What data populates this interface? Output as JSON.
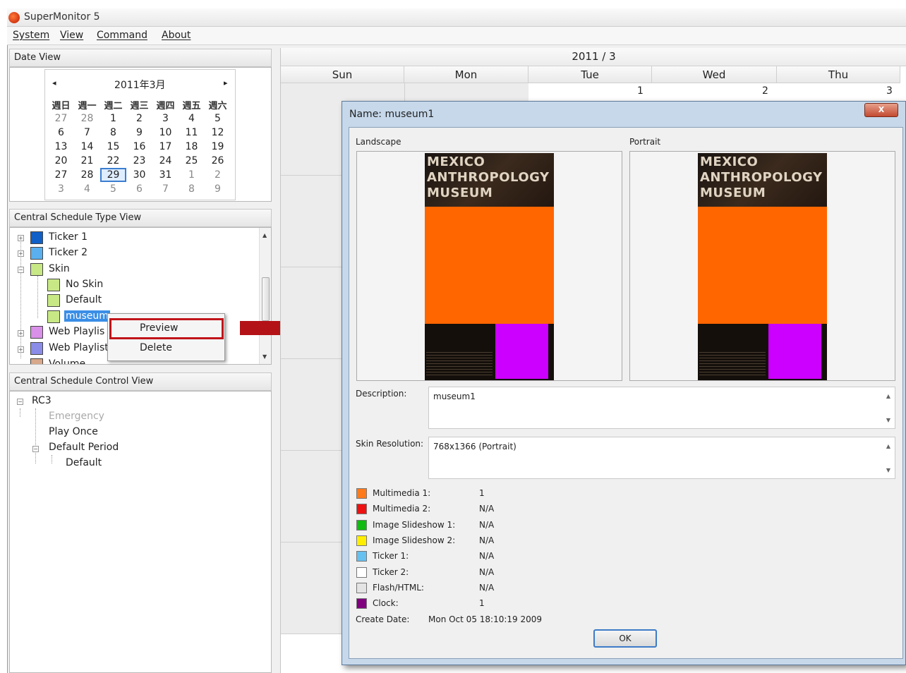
{
  "app": {
    "title": "SuperMonitor 5"
  },
  "menu": {
    "items": [
      "System",
      "View",
      "Command",
      "About"
    ]
  },
  "date_view": {
    "header": "Date View",
    "month_label": "2011年3月",
    "prev": "◂",
    "next": "▸",
    "weekdays": [
      "週日",
      "週一",
      "週二",
      "週三",
      "週四",
      "週五",
      "週六"
    ],
    "weeks": [
      [
        "27",
        "28",
        "1",
        "2",
        "3",
        "4",
        "5"
      ],
      [
        "6",
        "7",
        "8",
        "9",
        "10",
        "11",
        "12"
      ],
      [
        "13",
        "14",
        "15",
        "16",
        "17",
        "18",
        "19"
      ],
      [
        "20",
        "21",
        "22",
        "23",
        "24",
        "25",
        "26"
      ],
      [
        "27",
        "28",
        "29",
        "30",
        "31",
        "1",
        "2"
      ],
      [
        "3",
        "4",
        "5",
        "6",
        "7",
        "8",
        "9"
      ]
    ],
    "selected": "29"
  },
  "type_view": {
    "header": "Central Schedule Type View",
    "items": [
      {
        "label": "Ticker 1",
        "color": "#1060c8"
      },
      {
        "label": "Ticker 2",
        "color": "#5ab0ee"
      },
      {
        "label": "Skin",
        "color": "#c8e886"
      },
      {
        "label": "No Skin",
        "color": "#c8e886"
      },
      {
        "label": "Default",
        "color": "#c8e886"
      },
      {
        "label": "museum",
        "color": "#c8e886"
      },
      {
        "label": "Web Playlis",
        "color": "#d990e8"
      },
      {
        "label": "Web Playlist",
        "color": "#8a8ce8"
      },
      {
        "label": "Volume",
        "color": "#d8a88a"
      }
    ]
  },
  "context_menu": {
    "preview": "Preview",
    "delete": "Delete"
  },
  "control_view": {
    "header": "Central Schedule Control View",
    "items": [
      "RC3",
      "Emergency",
      "Play Once",
      "Default Period",
      "Default"
    ]
  },
  "schedule": {
    "month_header": "2011 / 3",
    "days": [
      "Sun",
      "Mon",
      "Tue",
      "Wed",
      "Thu"
    ],
    "dates": {
      "tue": "1",
      "wed": "2",
      "thu": "3"
    }
  },
  "dialog": {
    "title": "Name: museum1",
    "close": "X",
    "landscape_label": "Landscape",
    "portrait_label": "Portrait",
    "poster_lines": [
      "MEXICO",
      "ANTHROPOLOGY",
      "MUSEUM"
    ],
    "description_label": "Description:",
    "description_value": "museum1",
    "resolution_label": "Skin Resolution:",
    "resolution_value": "768x1366 (Portrait)",
    "legend": [
      {
        "label": "Multimedia 1:",
        "value": "1",
        "color": "#ff7a1a"
      },
      {
        "label": "Multimedia 2:",
        "value": "N/A",
        "color": "#ee1111"
      },
      {
        "label": "Image Slideshow 1:",
        "value": "N/A",
        "color": "#11bb11"
      },
      {
        "label": "Image Slideshow 2:",
        "value": "N/A",
        "color": "#ffee00"
      },
      {
        "label": "Ticker 1:",
        "value": "N/A",
        "color": "#66c0f0"
      },
      {
        "label": "Ticker 2:",
        "value": "N/A",
        "color": "#ffffff"
      },
      {
        "label": "Flash/HTML:",
        "value": "N/A",
        "color": "#e4e4e4"
      },
      {
        "label": "Clock:",
        "value": "1",
        "color": "#800080"
      }
    ],
    "create_label": "Create Date:",
    "create_value": "Mon Oct 05 18:10:19 2009",
    "ok": "OK"
  }
}
